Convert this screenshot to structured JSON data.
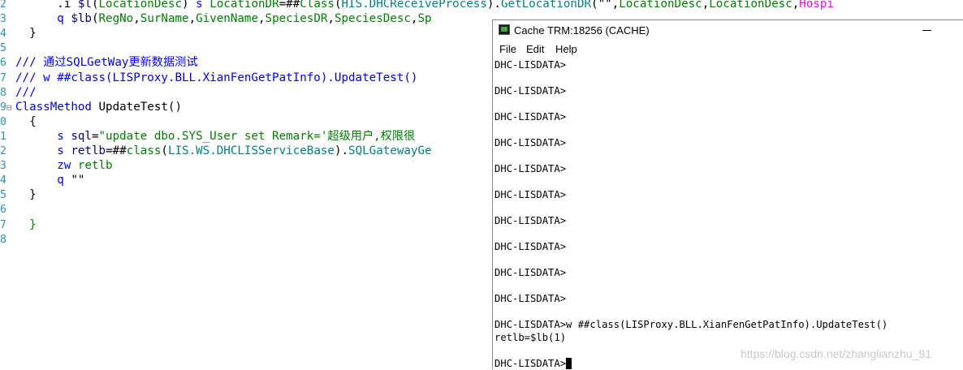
{
  "editor": {
    "lines": [
      {
        "num": "2",
        "fold": "",
        "indent": "      ",
        "parts": [
          {
            "c": "def",
            "t": ".i "
          },
          {
            "c": "var",
            "t": "$l"
          },
          {
            "c": "def",
            "t": "("
          },
          {
            "c": "grn",
            "t": "LocationDesc"
          },
          {
            "c": "def",
            "t": ") "
          },
          {
            "c": "kw",
            "t": "s "
          },
          {
            "c": "grn",
            "t": "LocationDR"
          },
          {
            "c": "def",
            "t": "=##"
          },
          {
            "c": "grn",
            "t": "Class"
          },
          {
            "c": "def",
            "t": "("
          },
          {
            "c": "cls",
            "t": "HIS.DHCReceiveProcess"
          },
          {
            "c": "def",
            "t": ")."
          },
          {
            "c": "cls",
            "t": "GetLocationDR"
          },
          {
            "c": "def",
            "t": "(\"\","
          },
          {
            "c": "grn",
            "t": "LocationDesc"
          },
          {
            "c": "def",
            "t": ","
          },
          {
            "c": "grn",
            "t": "LocationDesc"
          },
          {
            "c": "def",
            "t": ","
          },
          {
            "c": "pink",
            "t": "Hospi"
          }
        ]
      },
      {
        "num": "3",
        "fold": "",
        "indent": "      ",
        "parts": [
          {
            "c": "kw",
            "t": "q "
          },
          {
            "c": "var",
            "t": "$lb"
          },
          {
            "c": "def",
            "t": "("
          },
          {
            "c": "grn",
            "t": "RegNo"
          },
          {
            "c": "def",
            "t": ","
          },
          {
            "c": "grn",
            "t": "SurName"
          },
          {
            "c": "def",
            "t": ","
          },
          {
            "c": "grn",
            "t": "GivenName"
          },
          {
            "c": "def",
            "t": ","
          },
          {
            "c": "grn",
            "t": "SpeciesDR"
          },
          {
            "c": "def",
            "t": ","
          },
          {
            "c": "grn",
            "t": "SpeciesDesc"
          },
          {
            "c": "def",
            "t": ","
          },
          {
            "c": "grn",
            "t": "Sp"
          }
        ]
      },
      {
        "num": "4",
        "fold": "",
        "indent": "  ",
        "parts": [
          {
            "c": "def",
            "t": "}"
          }
        ]
      },
      {
        "num": "5",
        "fold": "",
        "indent": "",
        "parts": []
      },
      {
        "num": "6",
        "fold": "",
        "indent": "",
        "parts": [
          {
            "c": "kw",
            "t": "/// 通过SQLGetWay更新数据测试"
          }
        ]
      },
      {
        "num": "7",
        "fold": "",
        "indent": "",
        "parts": [
          {
            "c": "kw",
            "t": "/// w ##class(LISProxy.BLL.XianFenGetPatInfo).UpdateTest()"
          }
        ]
      },
      {
        "num": "8",
        "fold": "",
        "indent": "",
        "parts": [
          {
            "c": "kw",
            "t": "///"
          }
        ]
      },
      {
        "num": "9",
        "fold": "⊟",
        "indent": "",
        "parts": [
          {
            "c": "kw",
            "t": "ClassMethod "
          },
          {
            "c": "def",
            "t": "UpdateTest()"
          }
        ]
      },
      {
        "num": "0",
        "fold": "",
        "indent": "  ",
        "parts": [
          {
            "c": "def",
            "t": "{"
          }
        ]
      },
      {
        "num": "1",
        "fold": "",
        "indent": "      ",
        "parts": [
          {
            "c": "kw",
            "t": "s "
          },
          {
            "c": "var",
            "t": "sql"
          },
          {
            "c": "def",
            "t": "="
          },
          {
            "c": "grn",
            "t": "\"update dbo.SYS_User set Remark='超级用户,权限很"
          }
        ]
      },
      {
        "num": "2",
        "fold": "",
        "indent": "      ",
        "parts": [
          {
            "c": "kw",
            "t": "s "
          },
          {
            "c": "var",
            "t": "retlb"
          },
          {
            "c": "def",
            "t": "=##"
          },
          {
            "c": "grn",
            "t": "class"
          },
          {
            "c": "def",
            "t": "("
          },
          {
            "c": "cls",
            "t": "LIS.WS.DHCLISServiceBase"
          },
          {
            "c": "def",
            "t": ")."
          },
          {
            "c": "cls",
            "t": "SQLGatewayGe"
          }
        ]
      },
      {
        "num": "3",
        "fold": "",
        "indent": "      ",
        "parts": [
          {
            "c": "kw",
            "t": "zw "
          },
          {
            "c": "grn",
            "t": "retlb"
          }
        ]
      },
      {
        "num": "4",
        "fold": "",
        "indent": "      ",
        "parts": [
          {
            "c": "kw",
            "t": "q "
          },
          {
            "c": "def",
            "t": "\"\""
          }
        ]
      },
      {
        "num": "5",
        "fold": "",
        "indent": "  ",
        "parts": [
          {
            "c": "def",
            "t": "}"
          }
        ]
      },
      {
        "num": "6",
        "fold": "",
        "indent": "",
        "parts": []
      },
      {
        "num": "7",
        "fold": "",
        "indent": "  ",
        "parts": [
          {
            "c": "grn",
            "t": "}"
          }
        ]
      },
      {
        "num": "8",
        "fold": "",
        "indent": "",
        "parts": []
      }
    ]
  },
  "terminal": {
    "title": "Cache TRM:18256 (CACHE)",
    "menu": [
      "File",
      "Edit",
      "Help"
    ],
    "lines": [
      "DHC-LISDATA>",
      "",
      "DHC-LISDATA>",
      "",
      "DHC-LISDATA>",
      "",
      "DHC-LISDATA>",
      "",
      "DHC-LISDATA>",
      "",
      "DHC-LISDATA>",
      "",
      "DHC-LISDATA>",
      "",
      "DHC-LISDATA>",
      "",
      "DHC-LISDATA>",
      "",
      "DHC-LISDATA>",
      "",
      "DHC-LISDATA>w ##class(LISProxy.BLL.XianFenGetPatInfo).UpdateTest()",
      "retlb=$lb(1)",
      "",
      "DHC-LISDATA>"
    ]
  },
  "watermark": "https://blog.csdn.net/zhanglianzhu_91"
}
